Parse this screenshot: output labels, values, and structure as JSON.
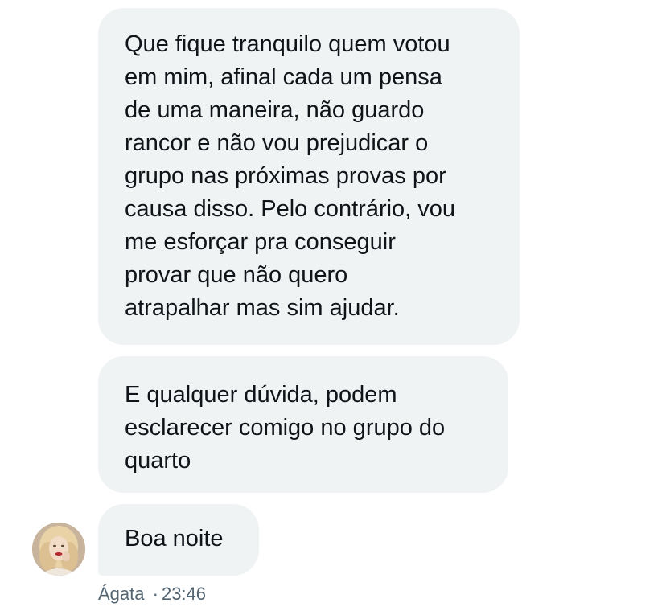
{
  "messages": [
    {
      "text": "Que fique tranquilo quem votou\nem mim, afinal cada um pensa\nde uma maneira, não guardo\nrancor e não vou prejudicar o\ngrupo nas próximas provas por\ncausa disso. Pelo contrário, vou\nme esforçar pra conseguir\nprovar que não quero\natrapalhar mas sim ajudar."
    },
    {
      "text": "E qualquer dúvida, podem\nesclarecer comigo no grupo do\nquarto"
    },
    {
      "text": "Boa noite"
    }
  ],
  "sender": {
    "name": "Ágata",
    "separator": "·",
    "time": "23:46",
    "avatar_icon": "user-avatar-photo"
  },
  "colors": {
    "bubble_background": "#eff3f4",
    "text": "#0f1419",
    "meta_text": "#536471"
  }
}
